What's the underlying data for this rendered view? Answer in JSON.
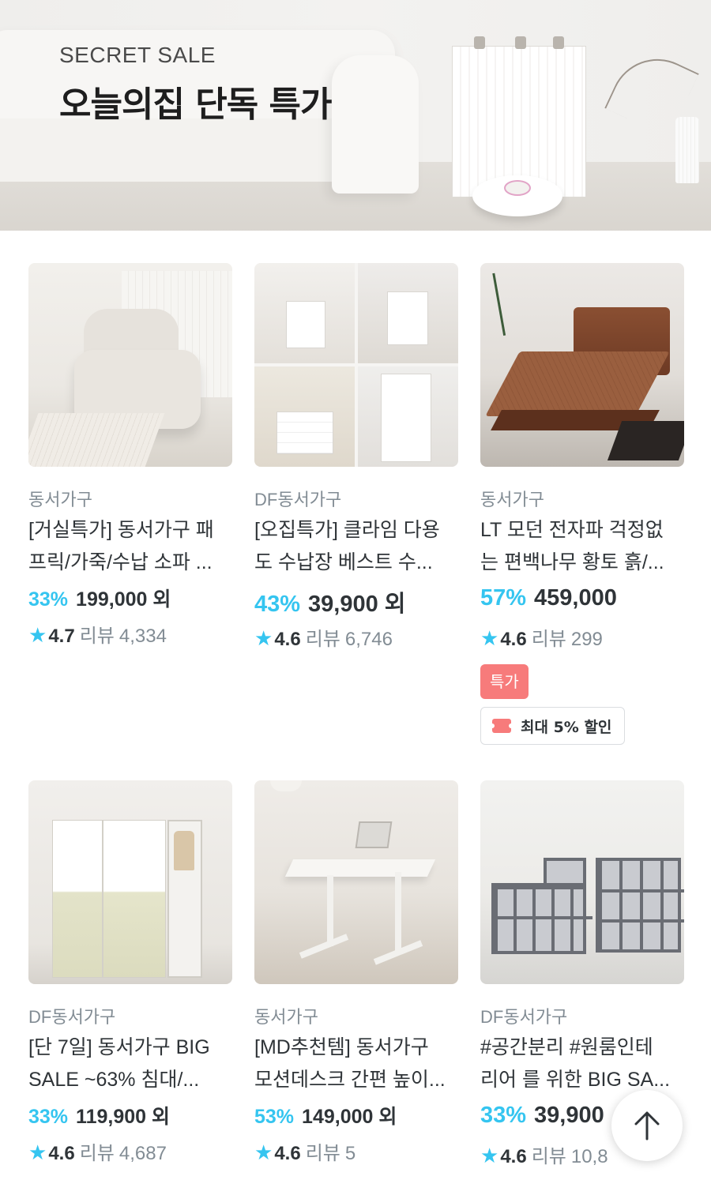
{
  "banner": {
    "kicker": "SECRET SALE",
    "headline": "오늘의집 단독 특가"
  },
  "colors": {
    "accent": "#35c5f0",
    "text": "#2f3438",
    "muted": "#828c94",
    "special_badge": "#f77b7b"
  },
  "products": [
    {
      "brand": "동서가구",
      "title_line1": "[거실특가] 동서가구 패",
      "title_line2": "프릭/가죽/수납 소파 ...",
      "discount": "33%",
      "price": "199,000 외",
      "rating": "4.7",
      "reviews_label": "리뷰",
      "reviews_count": "4,334",
      "image_icon": "armchair-photo"
    },
    {
      "brand": "DF동서가구",
      "title_line1": "[오집특가] 클라임 다용",
      "title_line2": "도 수납장 베스트 수...",
      "discount": "43%",
      "price": "39,900 외",
      "rating": "4.6",
      "reviews_label": "리뷰",
      "reviews_count": "6,746",
      "image_icon": "storage-collage-photo"
    },
    {
      "brand": "동서가구",
      "title_line1": "LT 모던 전자파 걱정없",
      "title_line2": "는 편백나무 황토 흙/...",
      "discount": "57%",
      "price": "459,000",
      "rating": "4.6",
      "reviews_label": "리뷰",
      "reviews_count": "299",
      "badge": "특가",
      "coupon": "최대 5% 할인",
      "image_icon": "bed-photo"
    },
    {
      "brand": "DF동서가구",
      "title_line1": "[단 7일] 동서가구 BIG",
      "title_line2": "SALE ~63% 침대/...",
      "discount": "33%",
      "price": "119,900 외",
      "rating": "4.6",
      "reviews_label": "리뷰",
      "reviews_count": "4,687",
      "image_icon": "wardrobe-photo"
    },
    {
      "brand": "동서가구",
      "title_line1": "[MD추천템] 동서가구",
      "title_line2": "모션데스크 간편 높이...",
      "discount": "53%",
      "price": "149,000 외",
      "rating": "4.6",
      "reviews_label": "리뷰",
      "reviews_count": "5",
      "image_icon": "desk-photo"
    },
    {
      "brand": "DF동서가구",
      "title_line1": "#공간분리 #원룸인테",
      "title_line2": "리어 를 위한 BIG SA...",
      "discount": "33%",
      "price": "39,900",
      "rating": "4.6",
      "reviews_label": "리뷰",
      "reviews_count": "10,8",
      "image_icon": "bookshelf-photo"
    }
  ],
  "scroll_top_icon": "arrow-up-icon"
}
